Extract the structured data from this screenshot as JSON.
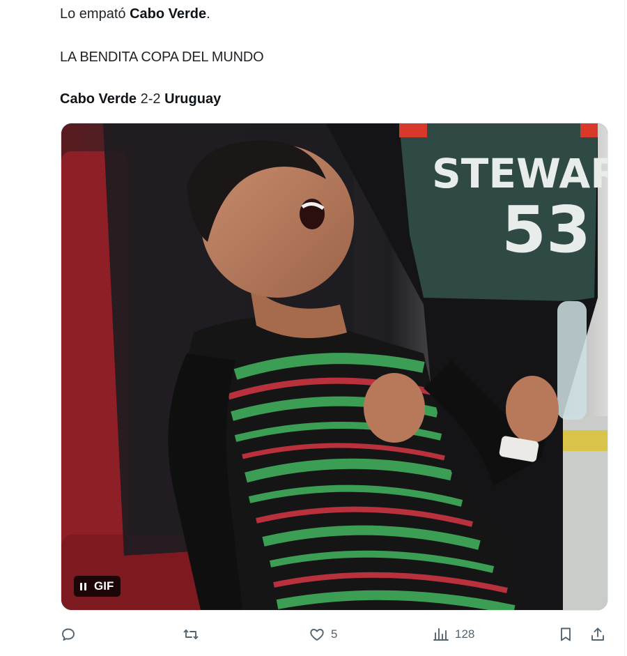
{
  "tweet": {
    "line1_prefix": "Lo empató ",
    "line1_bold": "Cabo Verde",
    "line1_suffix": ".",
    "line2": "LA BENDITA COPA DEL MUNDO",
    "score_team1": "Cabo Verde",
    "score_value": " 2-2 ",
    "score_team2": "Uruguay"
  },
  "media": {
    "type": "gif",
    "badge_label": "GIF",
    "vest_text": "STEWAR",
    "vest_number": "53",
    "colors": {
      "vest": "#2f4a44",
      "seat_red": "#8e1f26",
      "jacket_green": "#3fa659",
      "jacket_red": "#c2333f"
    }
  },
  "actions": {
    "reply_count": "",
    "retweet_count": "",
    "like_count": "5",
    "views_count": "128"
  }
}
